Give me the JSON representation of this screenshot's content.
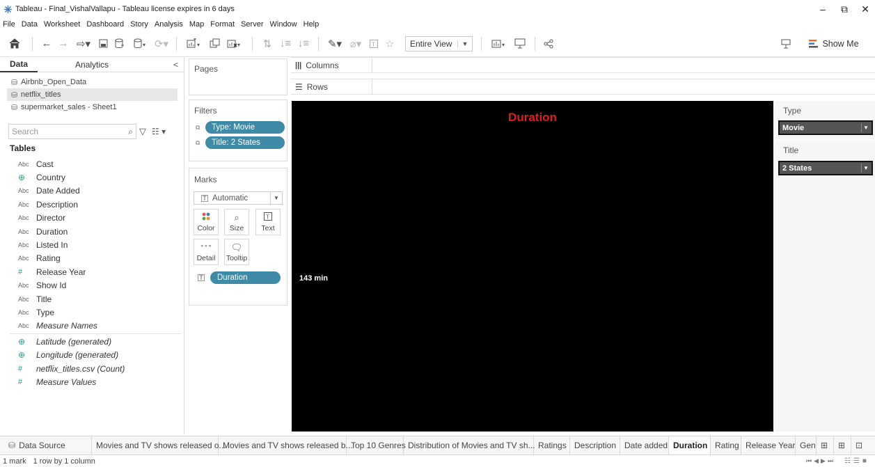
{
  "window": {
    "title": "Tableau - Final_VishalVallapu - Tableau license expires in 6 days",
    "minimize": "–",
    "restore": "⧉",
    "close": "✕"
  },
  "menu": [
    "File",
    "Data",
    "Worksheet",
    "Dashboard",
    "Story",
    "Analysis",
    "Map",
    "Format",
    "Server",
    "Window",
    "Help"
  ],
  "toolbar": {
    "fit_value": "Entire View",
    "show_me_label": "Show Me"
  },
  "data_pane": {
    "tabs": [
      "Data",
      "Analytics"
    ],
    "collapse": "<",
    "data_sources": [
      "Airbnb_Open_Data",
      "netflix_titles",
      "supermarket_sales - Sheet1"
    ],
    "search_placeholder": "Search",
    "tables_heading": "Tables",
    "fields": [
      {
        "type": "Abc",
        "name": "Cast"
      },
      {
        "type": "geo",
        "name": "Country"
      },
      {
        "type": "Abc",
        "name": "Date Added"
      },
      {
        "type": "Abc",
        "name": "Description"
      },
      {
        "type": "Abc",
        "name": "Director"
      },
      {
        "type": "Abc",
        "name": "Duration"
      },
      {
        "type": "Abc",
        "name": "Listed In"
      },
      {
        "type": "Abc",
        "name": "Rating"
      },
      {
        "type": "#",
        "name": "Release Year"
      },
      {
        "type": "Abc",
        "name": "Show Id"
      },
      {
        "type": "Abc",
        "name": "Title"
      },
      {
        "type": "Abc",
        "name": "Type"
      },
      {
        "type": "Abc",
        "name": "Measure Names"
      }
    ],
    "generated_fields": [
      {
        "type": "geo",
        "name": "Latitude (generated)"
      },
      {
        "type": "geo",
        "name": "Longitude (generated)"
      },
      {
        "type": "#",
        "name": "netflix_titles.csv (Count)"
      },
      {
        "type": "#",
        "name": "Measure Values"
      }
    ]
  },
  "pages": {
    "title": "Pages"
  },
  "filters": {
    "title": "Filters",
    "pills": [
      "Type: Movie",
      "Title: 2 States"
    ]
  },
  "marks": {
    "title": "Marks",
    "mark_type": "Automatic",
    "buttons": [
      "Color",
      "Size",
      "Text",
      "Detail",
      "Tooltip"
    ],
    "pill": "Duration"
  },
  "shelves": {
    "columns": "Columns",
    "rows": "Rows"
  },
  "viz": {
    "title": "Duration",
    "value_label": "143 min"
  },
  "filter_cards": [
    {
      "title": "Type",
      "value": "Movie"
    },
    {
      "title": "Title",
      "value": "2 States"
    }
  ],
  "sheet_tabs": [
    "Data Source",
    "Movies and TV shows released o...",
    "Movies and TV shows released b...",
    "Top 10 Genres",
    "Distribution of Movies and TV sh...",
    "Ratings",
    "Description",
    "Date added",
    "Duration",
    "Rating",
    "Release Year",
    "Gen"
  ],
  "active_sheet": "Duration",
  "status": {
    "marks": "1 mark",
    "dims": "1 row by 1 column"
  },
  "colors": {
    "pill": "#3f8aa6",
    "viz_bg": "#000000",
    "viz_title": "#e11d1d"
  }
}
